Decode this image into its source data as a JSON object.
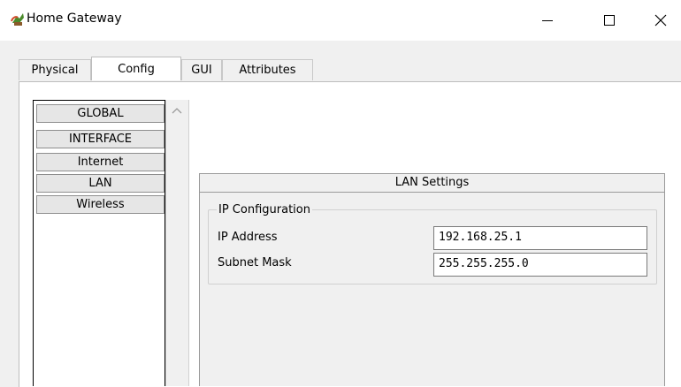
{
  "window": {
    "title": "Home Gateway",
    "icon": "app-cactus-icon",
    "controls": [
      "minimize-icon",
      "maximize-icon",
      "close-icon"
    ]
  },
  "tabs": [
    {
      "label": "Physical",
      "active": false
    },
    {
      "label": "Config",
      "active": true
    },
    {
      "label": "GUI",
      "active": false
    },
    {
      "label": "Attributes",
      "active": false
    }
  ],
  "sidebar": {
    "items": [
      {
        "label": "GLOBAL"
      },
      {
        "label": "INTERFACE"
      },
      {
        "label": "Internet"
      },
      {
        "label": "LAN"
      },
      {
        "label": "Wireless"
      }
    ],
    "scroll_icon": "chevron-up-icon"
  },
  "lan_settings": {
    "header": "LAN Settings",
    "group_title": "IP Configuration",
    "ip_address_label": "IP Address",
    "ip_address_value": "192.168.25.1",
    "subnet_mask_label": "Subnet Mask",
    "subnet_mask_value": "255.255.255.0"
  },
  "colors": {
    "window_bg": "#f0f0f0",
    "panel_bg": "#ffffff",
    "button_bg": "#e6e6e6"
  }
}
